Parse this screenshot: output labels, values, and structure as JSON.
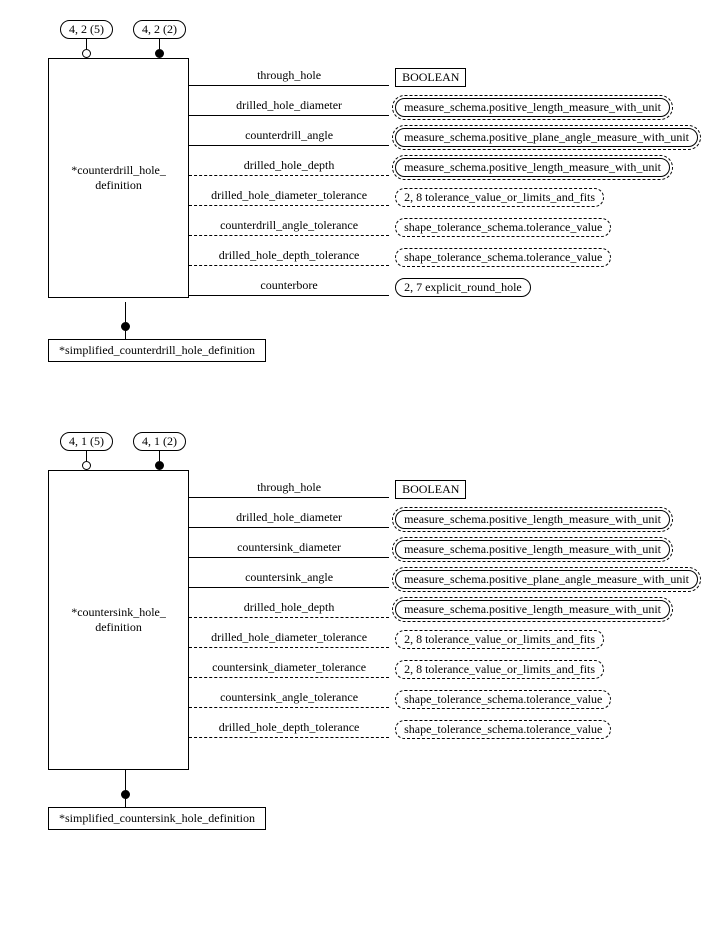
{
  "entities": [
    {
      "id": "counterdrill",
      "name": "*counterdrill_hole_\ndefinition",
      "supertypes": [
        {
          "label": "4, 2 (5)",
          "filled": false
        },
        {
          "label": "4, 2 (2)",
          "filled": true
        }
      ],
      "subtype": "*simplified_counterdrill_hole_definition",
      "attributes": [
        {
          "label": "through_hole",
          "optional": false,
          "style": "box",
          "target": "BOOLEAN"
        },
        {
          "label": "drilled_hole_diameter",
          "optional": false,
          "style": "double",
          "target": "measure_schema.positive_length_measure_with_unit"
        },
        {
          "label": "counterdrill_angle",
          "optional": false,
          "style": "double",
          "target": "measure_schema.positive_plane_angle_measure_with_unit"
        },
        {
          "label": "drilled_hole_depth",
          "optional": true,
          "style": "double",
          "target": "measure_schema.positive_length_measure_with_unit"
        },
        {
          "label": "drilled_hole_diameter_tolerance",
          "optional": true,
          "style": "dashed",
          "target": "2, 8 tolerance_value_or_limits_and_fits"
        },
        {
          "label": "counterdrill_angle_tolerance",
          "optional": true,
          "style": "dashed",
          "target": "shape_tolerance_schema.tolerance_value"
        },
        {
          "label": "drilled_hole_depth_tolerance",
          "optional": true,
          "style": "dashed",
          "target": "shape_tolerance_schema.tolerance_value"
        },
        {
          "label": "counterbore",
          "optional": false,
          "style": "pill",
          "target": "2, 7 explicit_round_hole"
        }
      ]
    },
    {
      "id": "countersink",
      "name": "*countersink_hole_\ndefinition",
      "supertypes": [
        {
          "label": "4, 1 (5)",
          "filled": false
        },
        {
          "label": "4, 1 (2)",
          "filled": true
        }
      ],
      "subtype": "*simplified_countersink_hole_definition",
      "attributes": [
        {
          "label": "through_hole",
          "optional": false,
          "style": "box",
          "target": "BOOLEAN"
        },
        {
          "label": "drilled_hole_diameter",
          "optional": false,
          "style": "double",
          "target": "measure_schema.positive_length_measure_with_unit"
        },
        {
          "label": "countersink_diameter",
          "optional": false,
          "style": "double",
          "target": "measure_schema.positive_length_measure_with_unit"
        },
        {
          "label": "countersink_angle",
          "optional": false,
          "style": "double",
          "target": "measure_schema.positive_plane_angle_measure_with_unit"
        },
        {
          "label": "drilled_hole_depth",
          "optional": true,
          "style": "double",
          "target": "measure_schema.positive_length_measure_with_unit"
        },
        {
          "label": "drilled_hole_diameter_tolerance",
          "optional": true,
          "style": "dashed",
          "target": "2, 8 tolerance_value_or_limits_and_fits"
        },
        {
          "label": "countersink_diameter_tolerance",
          "optional": true,
          "style": "dashed",
          "target": "2, 8 tolerance_value_or_limits_and_fits"
        },
        {
          "label": "countersink_angle_tolerance",
          "optional": true,
          "style": "dashed",
          "target": "shape_tolerance_schema.tolerance_value"
        },
        {
          "label": "drilled_hole_depth_tolerance",
          "optional": true,
          "style": "dashed",
          "target": "shape_tolerance_schema.tolerance_value"
        }
      ]
    }
  ]
}
